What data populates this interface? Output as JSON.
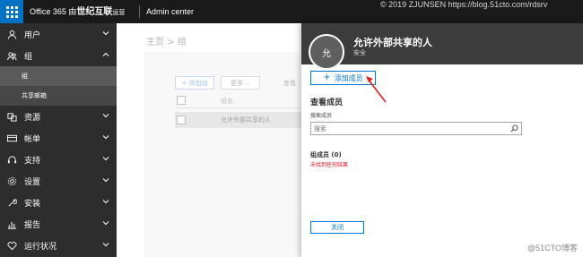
{
  "topbar": {
    "brand_prefix": "Office 365 由",
    "brand_name": "世纪互联",
    "brand_suffix": "运营",
    "section": "Admin center"
  },
  "watermarks": {
    "top": "© 2019 ZJUNSEN https://blog.51cto.com/rdsrv",
    "bottom": "@51CTO博客"
  },
  "sidebar": {
    "items": [
      {
        "label": "用户",
        "icon": "person-icon",
        "expanded": false
      },
      {
        "label": "组",
        "icon": "group-icon",
        "expanded": true
      },
      {
        "label": "组",
        "sub": true,
        "active": true
      },
      {
        "label": "共享邮箱",
        "sub": true,
        "active": false
      },
      {
        "label": "资源",
        "icon": "resources-icon",
        "expanded": false
      },
      {
        "label": "帐单",
        "icon": "billing-icon",
        "expanded": false
      },
      {
        "label": "支持",
        "icon": "headset-icon",
        "expanded": false
      },
      {
        "label": "设置",
        "icon": "gear-icon",
        "expanded": false
      },
      {
        "label": "安装",
        "icon": "wrench-icon",
        "expanded": false
      },
      {
        "label": "报告",
        "icon": "chart-icon",
        "expanded": false
      },
      {
        "label": "运行状况",
        "icon": "heart-icon",
        "expanded": false
      }
    ]
  },
  "main": {
    "breadcrumb": "主页 > 组",
    "add_group": "+ 添加组",
    "more": "更多 ⌵",
    "view_label": "查看",
    "column_name": "组名",
    "row_name": "允许外部共享的人"
  },
  "panel": {
    "avatar_text": "允",
    "title": "允许外部共享的人",
    "subtitle": "安全",
    "add_member": "添加成员",
    "view_members": "查看成员",
    "search_label": "搜索成员",
    "search_placeholder": "搜索",
    "members_count": "组成员 (0)",
    "no_results": "未找到任何结果",
    "close": "关闭"
  },
  "colors": {
    "topbar": "#1a1a1a",
    "waffle": "#0072c6",
    "sidebar": "#2d2d2d",
    "accent": "#0078d7",
    "error": "#e81123",
    "annotation": "#e02020"
  }
}
